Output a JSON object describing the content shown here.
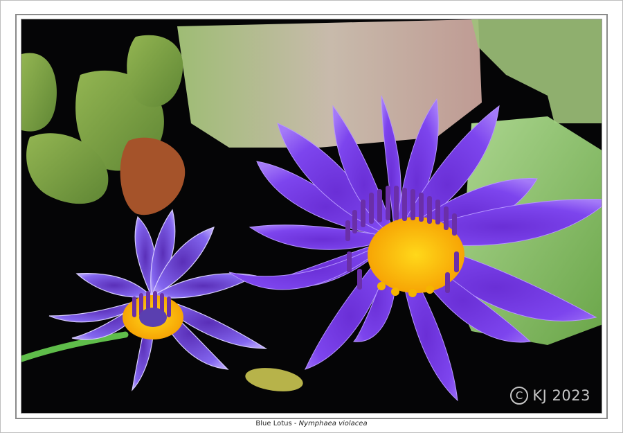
{
  "photo": {
    "alt": "Blue Lotus photograph",
    "watermark_symbol": "C",
    "watermark_text": "KJ 2023"
  },
  "caption": {
    "common_name": "Blue Lotus - ",
    "scientific_name": "Nymphaea violacea"
  },
  "colors": {
    "background": "#050506",
    "petal_main": "#7b3fe6",
    "petal_light": "#a06cf5",
    "petal_small": "#7a5ae8",
    "stamen_center": "#f5b400",
    "stamen_tips": "#6a2fa8",
    "leaf_green": "#7fb24a",
    "leaf_brown": "#a5532a",
    "pad_big": "#9ccf7a"
  }
}
